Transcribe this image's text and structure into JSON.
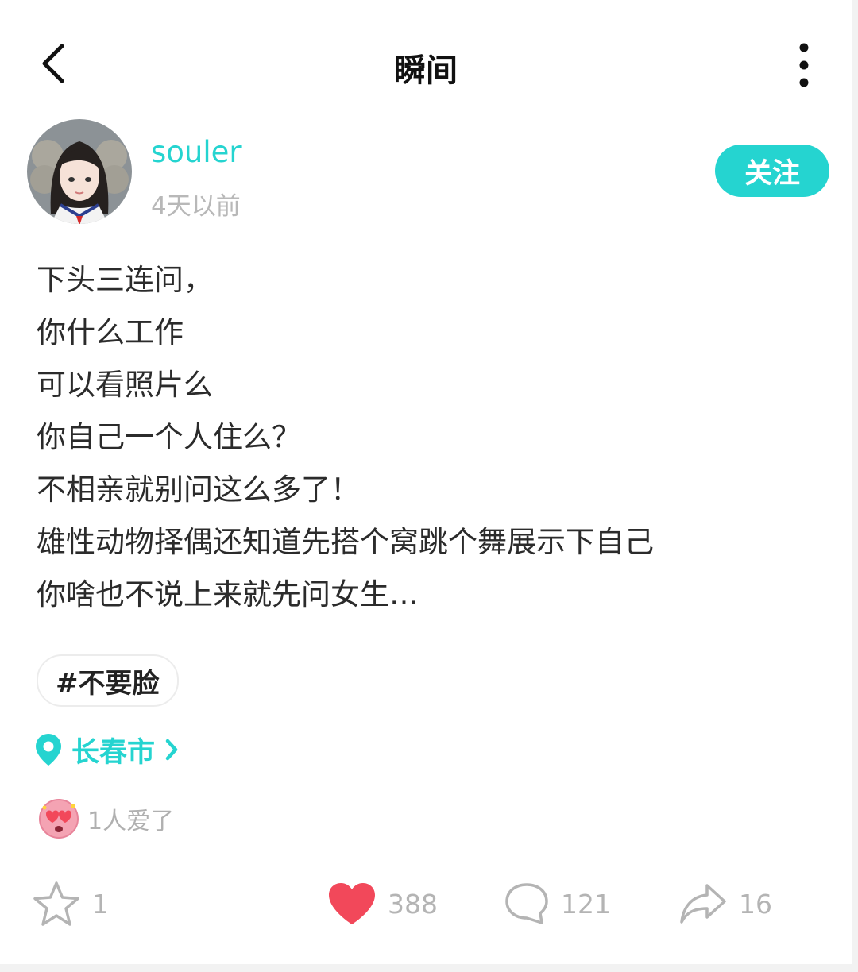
{
  "header": {
    "title": "瞬间",
    "back_icon": "chevron-left-icon",
    "more_icon": "more-vertical-icon"
  },
  "author": {
    "username": "souler",
    "time_ago": "4天以前",
    "follow_label": "关注"
  },
  "post": {
    "lines": [
      "下头三连问，",
      "你什么工作",
      "可以看照片么",
      "你自己一个人住么？",
      "不相亲就别问这么多了！",
      "雄性动物择偶还知道先搭个窝跳个舞展示下自己",
      "你啥也不说上来就先问女生…"
    ],
    "tag": "#不要脸",
    "location": "长春市"
  },
  "reactions": {
    "emoji": "heart-eyes-emoji",
    "text": "1人爱了"
  },
  "actions": {
    "star_count": "1",
    "like_count": "388",
    "comment_count": "121",
    "share_count": "16"
  },
  "colors": {
    "accent": "#25d4d0",
    "like": "#f2485a",
    "muted": "#b4b4b4"
  }
}
